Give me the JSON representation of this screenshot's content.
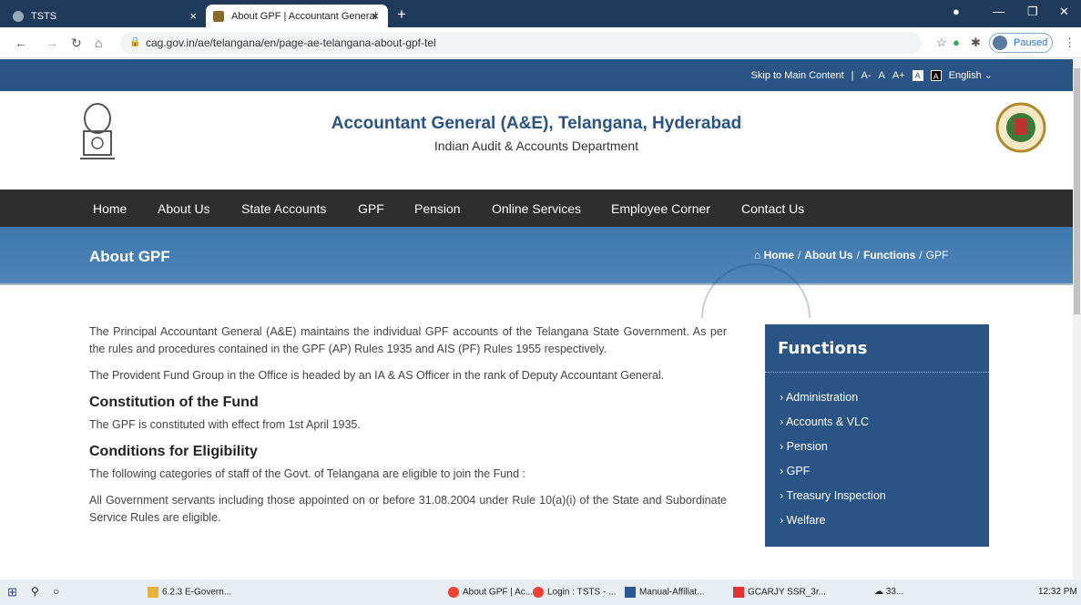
{
  "browser": {
    "tabs": [
      {
        "label": "TSTS"
      },
      {
        "label": "About GPF | Accountant General"
      }
    ],
    "url": "cag.gov.in/ae/telangana/en/page-ae-telangana-about-gpf-tel",
    "profile_status": "Paused"
  },
  "topbar": {
    "skip": "Skip to Main Content",
    "sep": "|",
    "font_small": "A-",
    "font_normal": "A",
    "font_large": "A+",
    "contrast_light": "A",
    "contrast_dark": "A",
    "language": "English ⌄"
  },
  "header": {
    "title": "Accountant General (A&E), Telangana, Hyderabad",
    "subtitle": "Indian Audit & Accounts Department",
    "emblem_motto": "सत्यमेव जयते",
    "seal_motto": "Dedicated to Truth in Public Interest"
  },
  "nav": [
    "Home",
    "About Us",
    "State Accounts",
    "GPF",
    "Pension",
    "Online Services",
    "Employee Corner",
    "Contact Us"
  ],
  "banner": {
    "title": "About GPF",
    "crumbs": [
      "Home",
      "About Us",
      "Functions",
      "GPF"
    ]
  },
  "content": {
    "p1": "The Principal Accountant General (A&E) maintains the individual GPF accounts of the Telangana State Government. As per the rules and procedures contained in the GPF (AP) Rules 1935 and AIS (PF) Rules 1955 respectively.",
    "p2": "The Provident Fund Group in the Office is headed by an IA & AS Officer in the rank of Deputy Accountant General.",
    "h1": "Constitution of the Fund",
    "p3": "The GPF is constituted with effect from 1st April 1935.",
    "h2": "Conditions for Eligibility",
    "p4": "The following categories of staff of the Govt. of Telangana are eligible to join the Fund :",
    "p5": "All Government servants including those appointed on or before 31.08.2004 under Rule 10(a)(i) of the State and Subordinate Service Rules are eligible."
  },
  "sidebar": {
    "heading": "Functions",
    "items": [
      "Administration",
      "Accounts & VLC",
      "Pension",
      "GPF",
      "Treasury Inspection",
      "Welfare"
    ]
  },
  "taskbar": {
    "items": [
      "6.2.3 E-Govern...",
      "About GPF | Ac...",
      "Login : TSTS - ...",
      "Manual-Affiliat...",
      "GCARJY SSR_3r..."
    ],
    "weather": "33...",
    "time": "12:32 PM"
  },
  "colors": {
    "brand_blue": "#2a5486",
    "nav_dark": "#2e2e2e"
  }
}
